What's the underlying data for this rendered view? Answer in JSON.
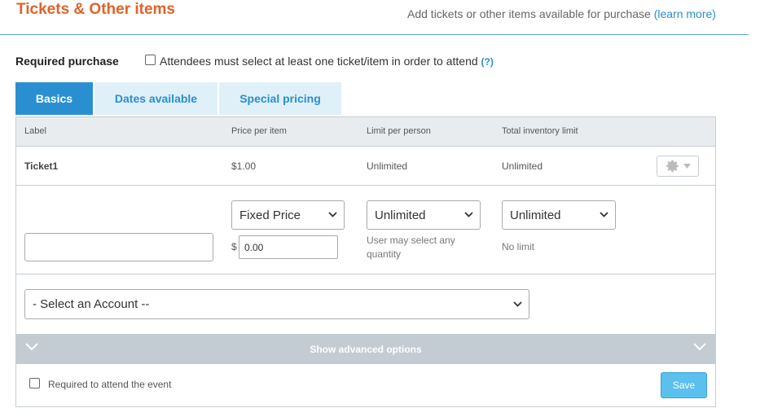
{
  "header": {
    "title": "Tickets & Other items",
    "subtitle": "Add tickets or other items available for purchase",
    "learn_more": "(learn more)"
  },
  "required_purchase": {
    "label": "Required purchase",
    "checkbox_text": "Attendees must select at least one ticket/item in order to attend",
    "help": "(?)",
    "checked": false
  },
  "tabs": [
    {
      "label": "Basics",
      "active": true
    },
    {
      "label": "Dates available",
      "active": false
    },
    {
      "label": "Special pricing",
      "active": false
    }
  ],
  "table": {
    "columns": [
      "Label",
      "Price per item",
      "Limit per person",
      "Total inventory limit"
    ],
    "rows": [
      {
        "label": "Ticket1",
        "price": "$1.00",
        "limit": "Unlimited",
        "inventory": "Unlimited",
        "actions_icon": "gear-icon"
      }
    ]
  },
  "edit_form": {
    "label_value": "",
    "price_type": "Fixed Price",
    "currency_symbol": "$",
    "price_value": "0.00",
    "limit_per_person": "Unlimited",
    "limit_hint": "User may select any quantity",
    "inventory_limit": "Unlimited",
    "inventory_hint": "No limit",
    "account_select": "- Select an Account --"
  },
  "advanced": {
    "label": "Show advanced options",
    "icon": "chevron-down-icon"
  },
  "footer": {
    "required_checkbox_text": "Required to attend the event",
    "required_checked": false,
    "save_label": "Save"
  },
  "colors": {
    "title": "#e0632a",
    "accent": "#2a8fd0",
    "tab_inactive_bg": "#dff0f8",
    "advanced_bar": "#c3cbd3",
    "save_button": "#5bc0ee"
  }
}
